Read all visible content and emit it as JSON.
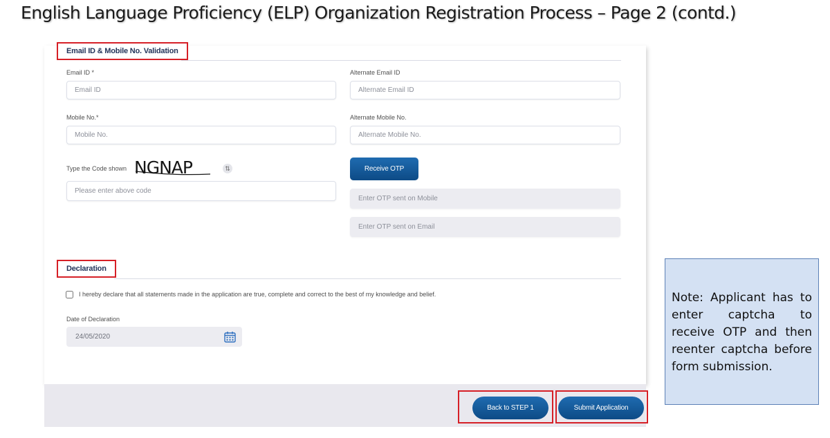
{
  "slide": {
    "title": "English Language Proficiency (ELP) Organization Registration Process – Page 2 (contd.)"
  },
  "sections": {
    "email_mobile": {
      "heading": "Email ID & Mobile No. Validation"
    },
    "declaration": {
      "heading": "Declaration"
    }
  },
  "fields": {
    "email": {
      "label": "Email ID *",
      "placeholder": "Email ID"
    },
    "alt_email": {
      "label": "Alternate Email ID",
      "placeholder": "Alternate Email ID"
    },
    "mobile": {
      "label": "Mobile No.*",
      "placeholder": "Mobile No."
    },
    "alt_mobile": {
      "label": "Alternate Mobile No.",
      "placeholder": "Alternate Mobile No."
    },
    "captcha": {
      "label": "Type the Code shown",
      "code": "NGNAP",
      "placeholder": "Please enter above code"
    },
    "otp_mobile": {
      "placeholder": "Enter OTP sent on Mobile"
    },
    "otp_email": {
      "placeholder": "Enter OTP sent on Email"
    }
  },
  "buttons": {
    "receive_otp": "Receive OTP",
    "back": "Back to STEP 1",
    "submit": "Submit Application"
  },
  "declaration": {
    "text": "I hereby declare that all statements made in the application are true, complete and correct to the best of my knowledge and belief.",
    "date_label": "Date of Declaration",
    "date_value": "24/05/2020"
  },
  "note": {
    "text": "Note: Applicant has to enter captcha to receive OTP and then reenter captcha before form submission."
  },
  "colors": {
    "accent": "#0d4b86",
    "highlight_border": "#d61f26",
    "note_background": "#d4e1f3"
  }
}
